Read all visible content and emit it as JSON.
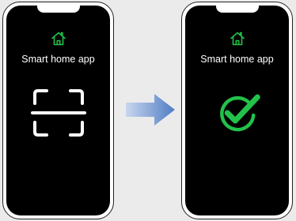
{
  "phone_before": {
    "app_title": "Smart home app",
    "header_icon": "home-icon",
    "center_icon": "scan-frame-icon"
  },
  "phone_after": {
    "app_title": "Smart home app",
    "header_icon": "home-icon",
    "center_icon": "checkmark-circle-icon"
  },
  "transition_icon": "arrow-right-icon",
  "colors": {
    "background": "#ebebeb",
    "phone_frame": "#ffffff",
    "screen": "#000000",
    "accent_green": "#22c24a",
    "arrow_blue": "#5b86c8"
  }
}
